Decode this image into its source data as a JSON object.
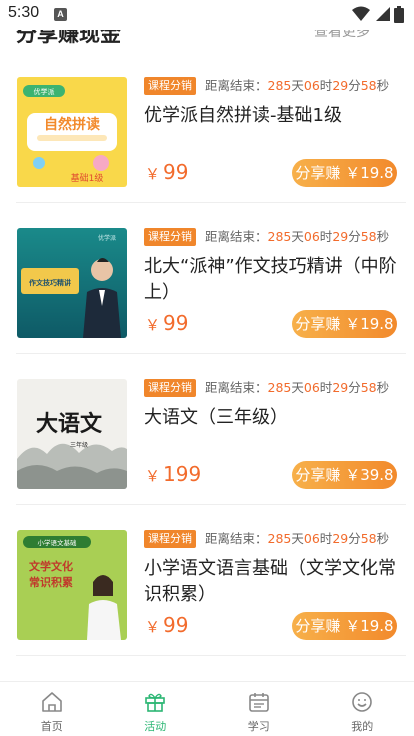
{
  "status_bar": {
    "time": "5:30",
    "app_icon_letter": "A"
  },
  "section": {
    "title": "分享赚现金",
    "more": "查看更多"
  },
  "countdown": {
    "label": "距离结束：",
    "days": "285",
    "day_unit": "天",
    "hours": "06",
    "hour_unit": "时",
    "minutes": "29",
    "minute_unit": "分",
    "seconds": "58",
    "second_unit": "秒"
  },
  "courses": [
    {
      "tag": "课程分销",
      "title": "优学派自然拼读-基础1级",
      "price": "99",
      "share_label": "分享赚",
      "share_amount": "￥19.8",
      "thumb": {
        "brand": "优学派",
        "main": "自然拼读",
        "level": "基础1级"
      }
    },
    {
      "tag": "课程分销",
      "title": "北大“派神”作文技巧精讲（中阶上）",
      "price": "99",
      "share_label": "分享赚",
      "share_amount": "￥19.8",
      "thumb": {
        "brand": "优学派",
        "main": "作文技巧精讲"
      }
    },
    {
      "tag": "课程分销",
      "title": "大语文（三年级）",
      "price": "199",
      "share_label": "分享赚",
      "share_amount": "￥39.8",
      "thumb": {
        "main": "大语文",
        "sub": "三年级"
      }
    },
    {
      "tag": "课程分销",
      "title": "小学语文语言基础（文学文化常识积累）",
      "price": "99",
      "share_label": "分享赚",
      "share_amount": "￥19.8",
      "thumb": {
        "badge": "小学语文基础",
        "main_line1": "文学文化",
        "main_line2": "常识积累"
      }
    }
  ],
  "currency": "￥",
  "tabbar": [
    {
      "label": "首页",
      "icon": "home-icon",
      "active": false
    },
    {
      "label": "活动",
      "icon": "gift-icon",
      "active": true
    },
    {
      "label": "学习",
      "icon": "calendar-icon",
      "active": false
    },
    {
      "label": "我的",
      "icon": "smile-icon",
      "active": false
    }
  ],
  "colors": {
    "accent_orange": "#f26b2c",
    "tag_orange": "#f0862b",
    "active_green": "#2bb673"
  }
}
